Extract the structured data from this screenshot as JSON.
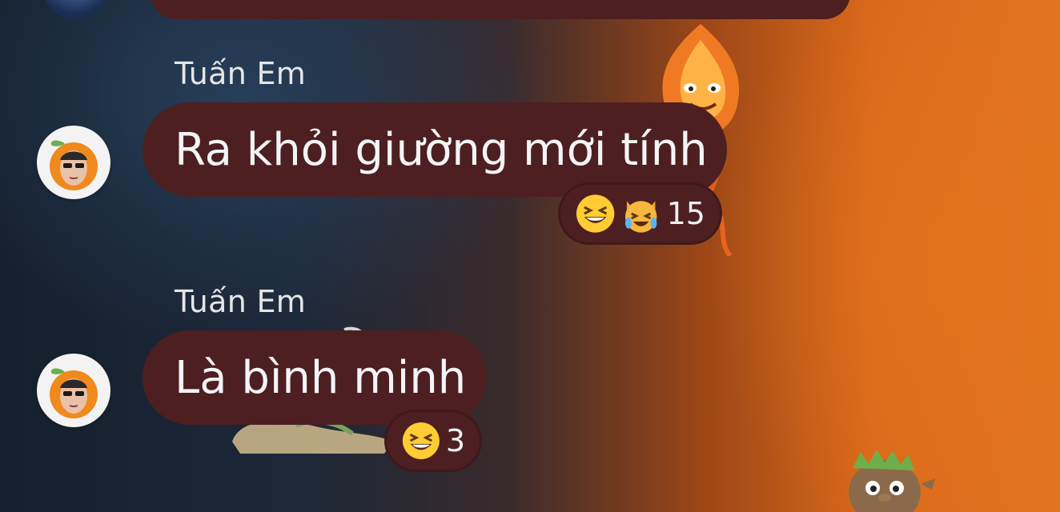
{
  "messages": [
    {
      "sender": "Tuấn Em",
      "text": "Ra khỏi giường mới tính",
      "reactions": {
        "icons": [
          "grinning-squinting-face-icon",
          "cat-tears-of-joy-icon"
        ],
        "count": "15"
      }
    },
    {
      "sender": "Tuấn Em",
      "text": "Là bình minh",
      "reactions": {
        "icons": [
          "grinning-squinting-face-icon"
        ],
        "count": "3"
      }
    }
  ],
  "colors": {
    "bubble": "#4d1f21",
    "text": "#f4f4f4",
    "sender_text": "#e6e6e6"
  }
}
